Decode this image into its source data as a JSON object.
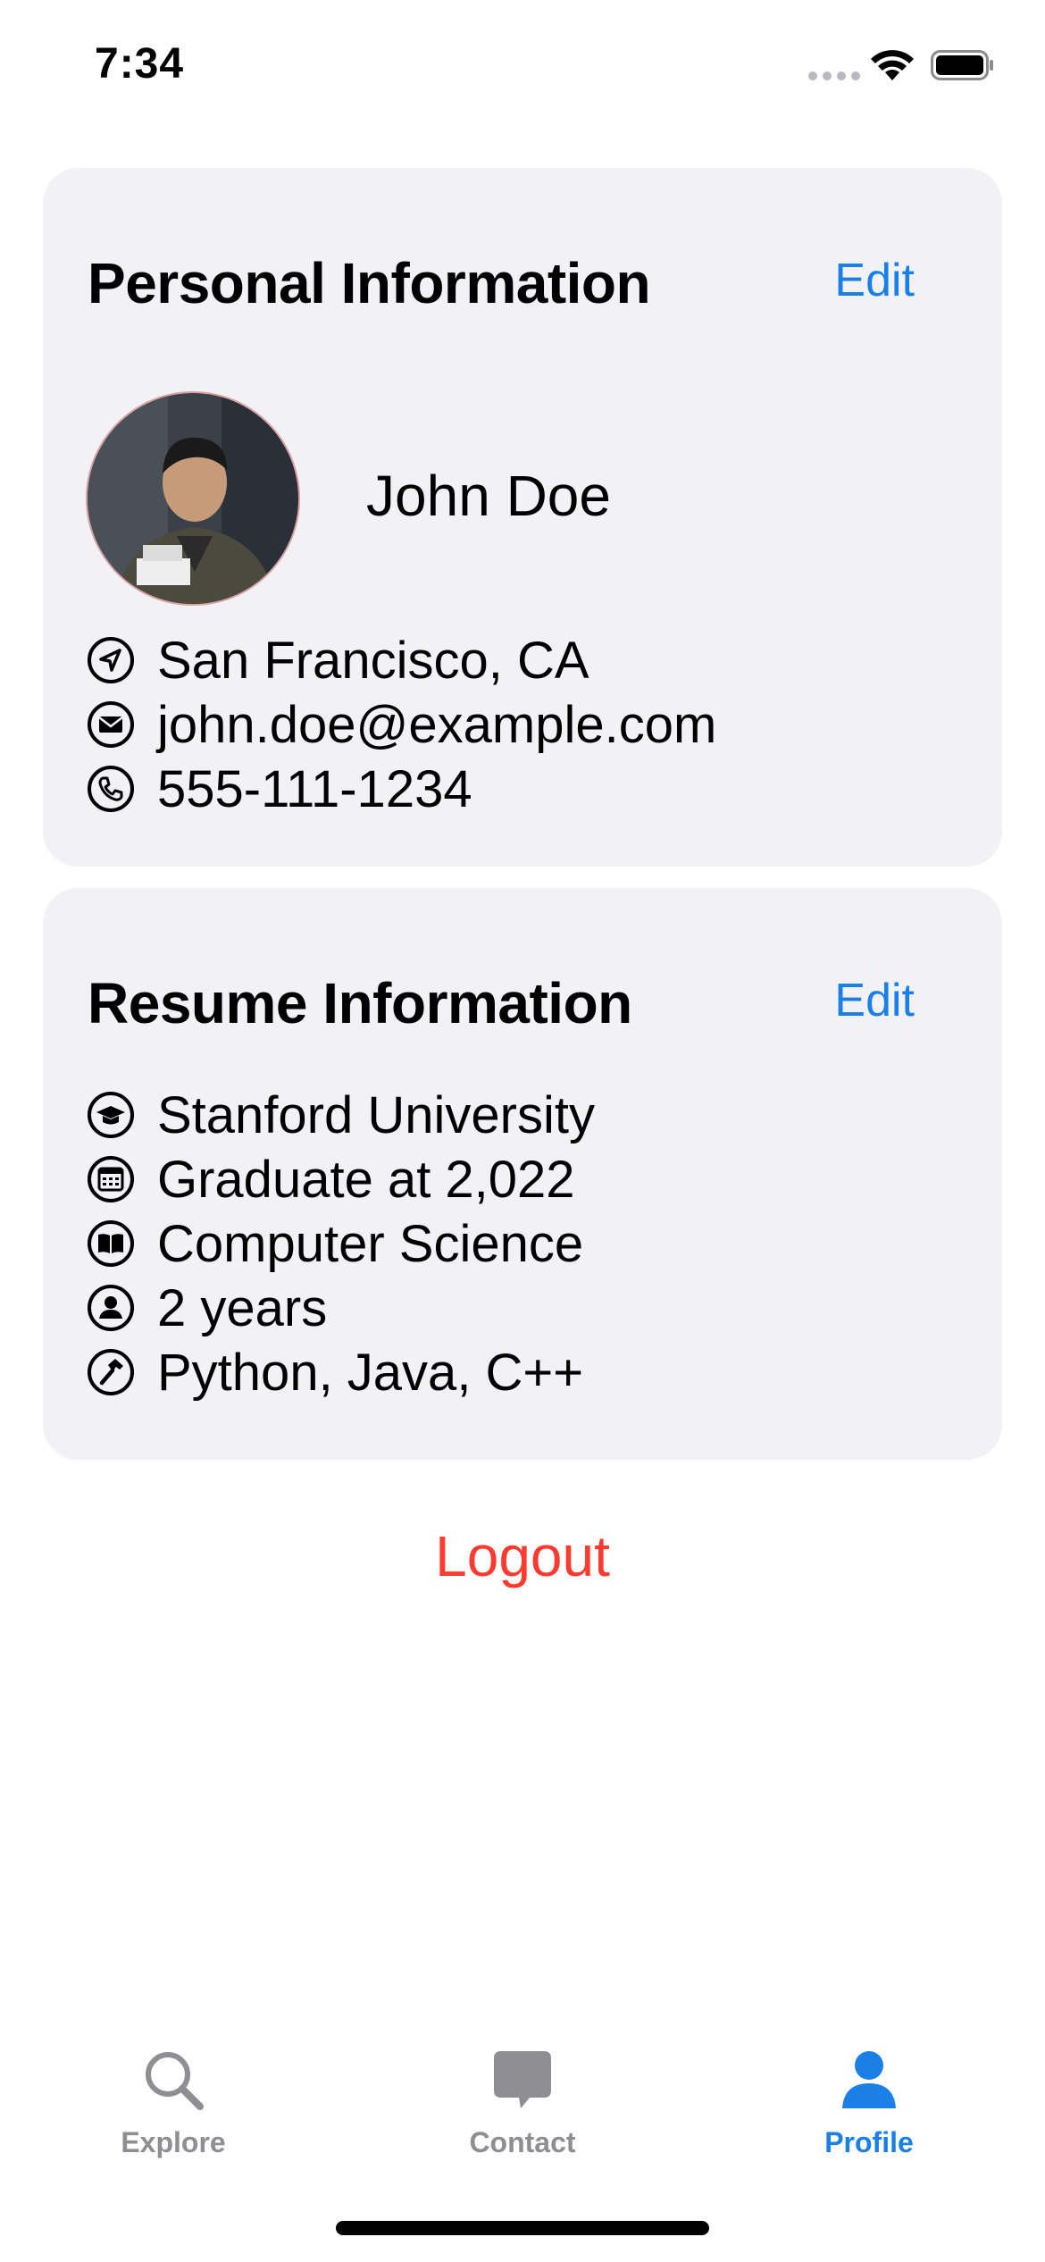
{
  "status_bar": {
    "time": "7:34"
  },
  "personal": {
    "title": "Personal Information",
    "edit_label": "Edit",
    "name": "John Doe",
    "items": [
      {
        "icon": "location-arrow-icon",
        "text": "San Francisco, CA"
      },
      {
        "icon": "envelope-icon",
        "text": "john.doe@example.com"
      },
      {
        "icon": "phone-icon",
        "text": "555-111-1234"
      }
    ]
  },
  "resume": {
    "title": "Resume Information",
    "edit_label": "Edit",
    "items": [
      {
        "icon": "graduation-cap-icon",
        "text": "Stanford University"
      },
      {
        "icon": "calendar-icon",
        "text": "Graduate at 2,022"
      },
      {
        "icon": "book-icon",
        "text": "Computer Science"
      },
      {
        "icon": "person-icon",
        "text": "2 years"
      },
      {
        "icon": "hammer-icon",
        "text": "Python, Java, C++"
      }
    ]
  },
  "logout_label": "Logout",
  "tabs": [
    {
      "icon": "magnifying-glass-icon",
      "label": "Explore",
      "selected": false
    },
    {
      "icon": "message-bubble-icon",
      "label": "Contact",
      "selected": false
    },
    {
      "icon": "person-icon",
      "label": "Profile",
      "selected": true
    }
  ],
  "colors": {
    "accent": "#1a7fe6",
    "destructive": "#ff3b30",
    "card_bg": "#f1f1f6",
    "inactive": "#8e8e93"
  }
}
